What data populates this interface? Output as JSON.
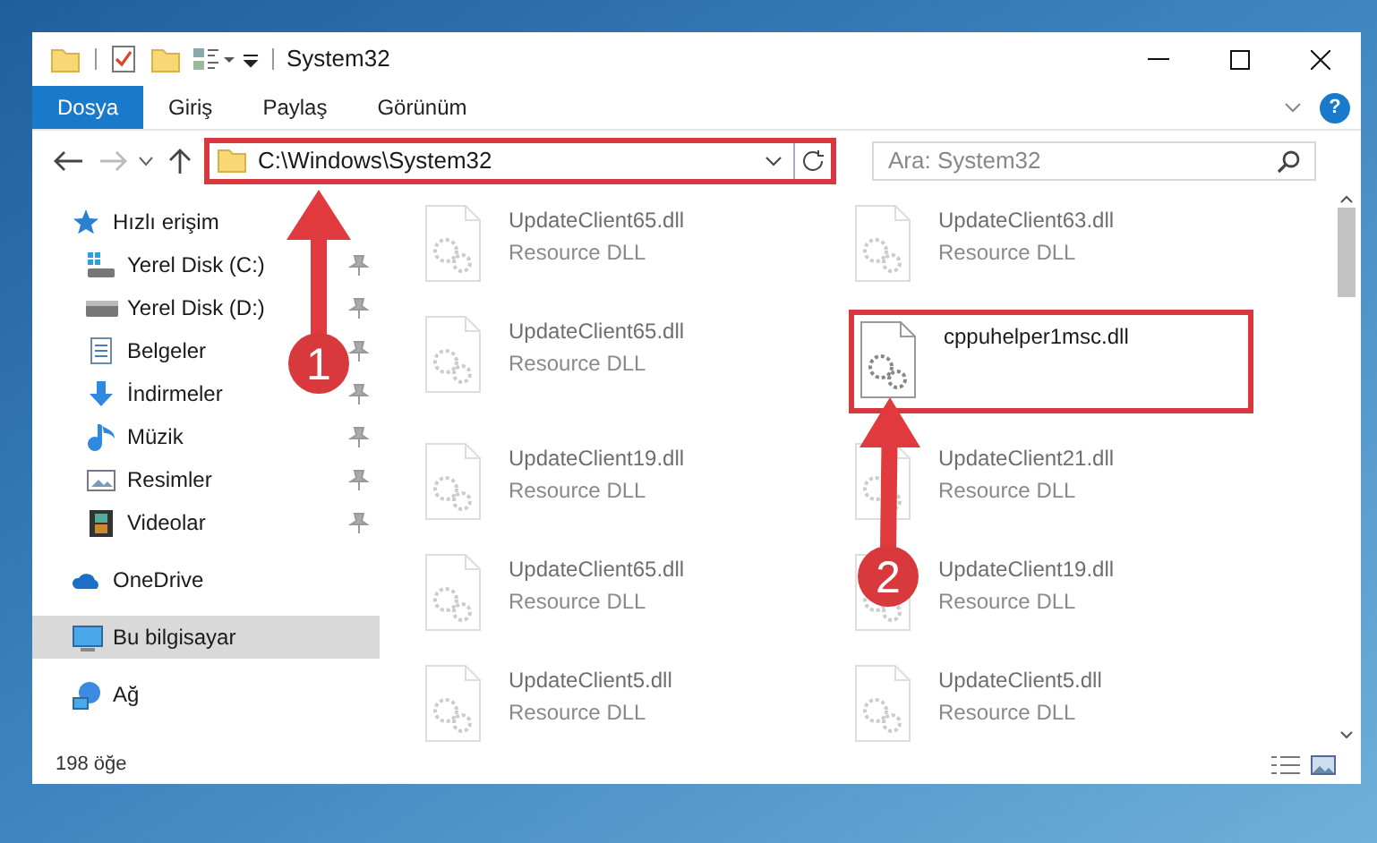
{
  "window": {
    "title": "System32"
  },
  "ribbon_tabs": [
    {
      "label": "Dosya",
      "selected": true
    },
    {
      "label": "Giriş",
      "selected": false
    },
    {
      "label": "Paylaş",
      "selected": false
    },
    {
      "label": "Görünüm",
      "selected": false
    }
  ],
  "help_button": {
    "label": "?"
  },
  "address_bar": {
    "path": "C:\\Windows\\System32",
    "highlighted": true
  },
  "search": {
    "placeholder": "Ara: System32"
  },
  "sidebar": {
    "items": [
      {
        "label": "Hızlı erişim",
        "kind": "star",
        "selected": false,
        "children": [
          {
            "label": "Yerel Disk (C:)",
            "kind": "system-drive",
            "pinned": true
          },
          {
            "label": "Yerel Disk (D:)",
            "kind": "drive",
            "pinned": true
          },
          {
            "label": "Belgeler",
            "kind": "document",
            "pinned": true
          },
          {
            "label": "İndirmeler",
            "kind": "download",
            "pinned": true
          },
          {
            "label": "Müzik",
            "kind": "music",
            "pinned": true
          },
          {
            "label": "Resimler",
            "kind": "image",
            "pinned": true
          },
          {
            "label": "Videolar",
            "kind": "film",
            "pinned": true
          }
        ]
      },
      {
        "label": "OneDrive",
        "kind": "cloud",
        "selected": false
      },
      {
        "label": "Bu bilgisayar",
        "kind": "computer",
        "selected": true
      },
      {
        "label": "Ağ",
        "kind": "network",
        "selected": false
      }
    ]
  },
  "files": [
    {
      "name": "UpdateClient65.dll",
      "type": "Resource DLL",
      "faded": true,
      "highlighted": false
    },
    {
      "name": "UpdateClient63.dll",
      "type": "Resource DLL",
      "faded": true,
      "highlighted": false
    },
    {
      "name": "UpdateClient65.dll",
      "type": "Resource DLL",
      "faded": true,
      "highlighted": false
    },
    {
      "name": "cppuhelper1msc.dll",
      "faded": false,
      "highlighted": true
    },
    {
      "name": "UpdateClient19.dll",
      "type": "Resource DLL",
      "faded": true,
      "highlighted": false
    },
    {
      "name": "UpdateClient21.dll",
      "type": "Resource DLL",
      "faded": true,
      "highlighted": false
    },
    {
      "name": "UpdateClient65.dll",
      "type": "Resource DLL",
      "faded": true,
      "highlighted": false
    },
    {
      "name": "UpdateClient19.dll",
      "type": "Resource DLL",
      "faded": true,
      "highlighted": false
    },
    {
      "name": "UpdateClient5.dll",
      "type": "Resource DLL",
      "faded": true,
      "highlighted": false
    },
    {
      "name": "UpdateClient5.dll",
      "type": "Resource DLL",
      "faded": true,
      "highlighted": false
    }
  ],
  "status_bar": {
    "count": "198 öğe"
  },
  "annotations": [
    {
      "label": "1"
    },
    {
      "label": "2"
    }
  ]
}
